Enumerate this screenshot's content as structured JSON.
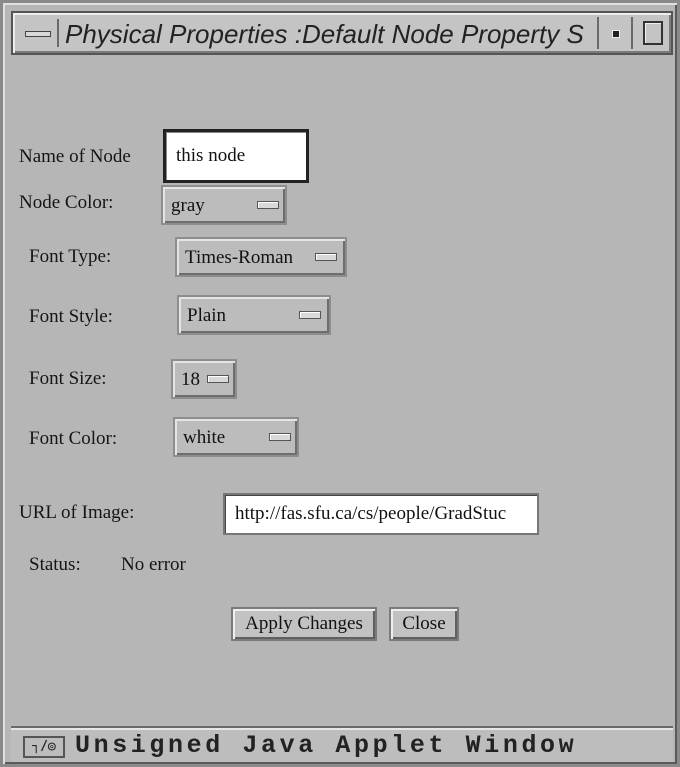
{
  "window": {
    "title": "Physical Properties :Default Node Property S",
    "footer_text": "Unsigned Java Applet Window",
    "footer_icon": "┐/◎"
  },
  "form": {
    "name_label": "Name of Node",
    "name_value": "this node",
    "node_color_label": "Node Color:",
    "node_color_value": "gray",
    "font_type_label": "Font Type:",
    "font_type_value": "Times-Roman",
    "font_style_label": "Font Style:",
    "font_style_value": "Plain",
    "font_size_label": "Font Size:",
    "font_size_value": "18",
    "font_color_label": "Font Color:",
    "font_color_value": "white",
    "url_label": "URL of Image:",
    "url_value": "http://fas.sfu.ca/cs/people/GradStuc",
    "status_label": "Status:",
    "status_value": "No error"
  },
  "buttons": {
    "apply": "Apply Changes",
    "close": "Close"
  },
  "icons": {
    "window_menu": "window-menu-icon",
    "minimize": "minimize-icon",
    "maximize": "maximize-icon",
    "choice_indicator": "dropdown-indicator-icon",
    "applet": "java-applet-icon"
  }
}
